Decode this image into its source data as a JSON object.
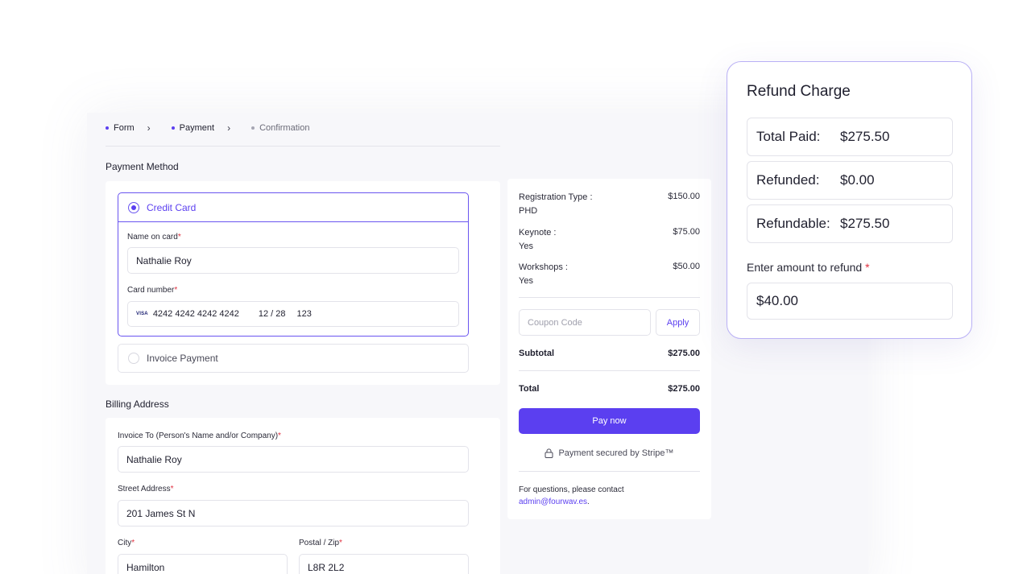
{
  "steps": [
    {
      "label": "Form"
    },
    {
      "label": "Payment"
    },
    {
      "label": "Confirmation"
    }
  ],
  "payment_method": {
    "title": "Payment Method",
    "credit_card_label": "Credit Card",
    "name_on_card_label": "Name on card",
    "name_on_card_value": "Nathalie Roy",
    "card_number_label": "Card number",
    "card_brand": "VISA",
    "card_number": "4242 4242 4242 4242",
    "card_expiry": "12 / 28",
    "card_cvc": "123",
    "invoice_label": "Invoice Payment"
  },
  "billing": {
    "title": "Billing Address",
    "invoice_to_label": "Invoice To (Person's Name and/or Company)",
    "invoice_to_value": "Nathalie Roy",
    "street_label": "Street Address",
    "street_value": "201 James St N",
    "city_label": "City",
    "city_value": "Hamilton",
    "postal_label": "Postal / Zip",
    "postal_value": "L8R 2L2"
  },
  "required_mark": "*",
  "summary": {
    "items": [
      {
        "label": "Registration Type :",
        "sub": "PHD",
        "amount": "$150.00"
      },
      {
        "label": "Keynote :",
        "sub": "Yes",
        "amount": "$75.00"
      },
      {
        "label": "Workshops :",
        "sub": "Yes",
        "amount": "$50.00"
      }
    ],
    "coupon_placeholder": "Coupon Code",
    "apply_label": "Apply",
    "subtotal_label": "Subtotal",
    "subtotal_value": "$275.00",
    "total_label": "Total",
    "total_value": "$275.00",
    "pay_label": "Pay now",
    "secure_text": "Payment secured by Stripe™",
    "contact_text": "For questions, please contact",
    "contact_email": "admin@fourwav.es",
    "contact_end": "."
  },
  "refund": {
    "title": "Refund Charge",
    "rows": [
      {
        "label": "Total Paid:",
        "value": "$275.50"
      },
      {
        "label": "Refunded:",
        "value": "$0.00"
      },
      {
        "label": "Refundable:",
        "value": "$275.50"
      }
    ],
    "enter_label": "Enter amount to refund",
    "amount_value": "$40.00"
  },
  "colors": {
    "accent": "#5b3ff0",
    "required": "#e0303f"
  }
}
